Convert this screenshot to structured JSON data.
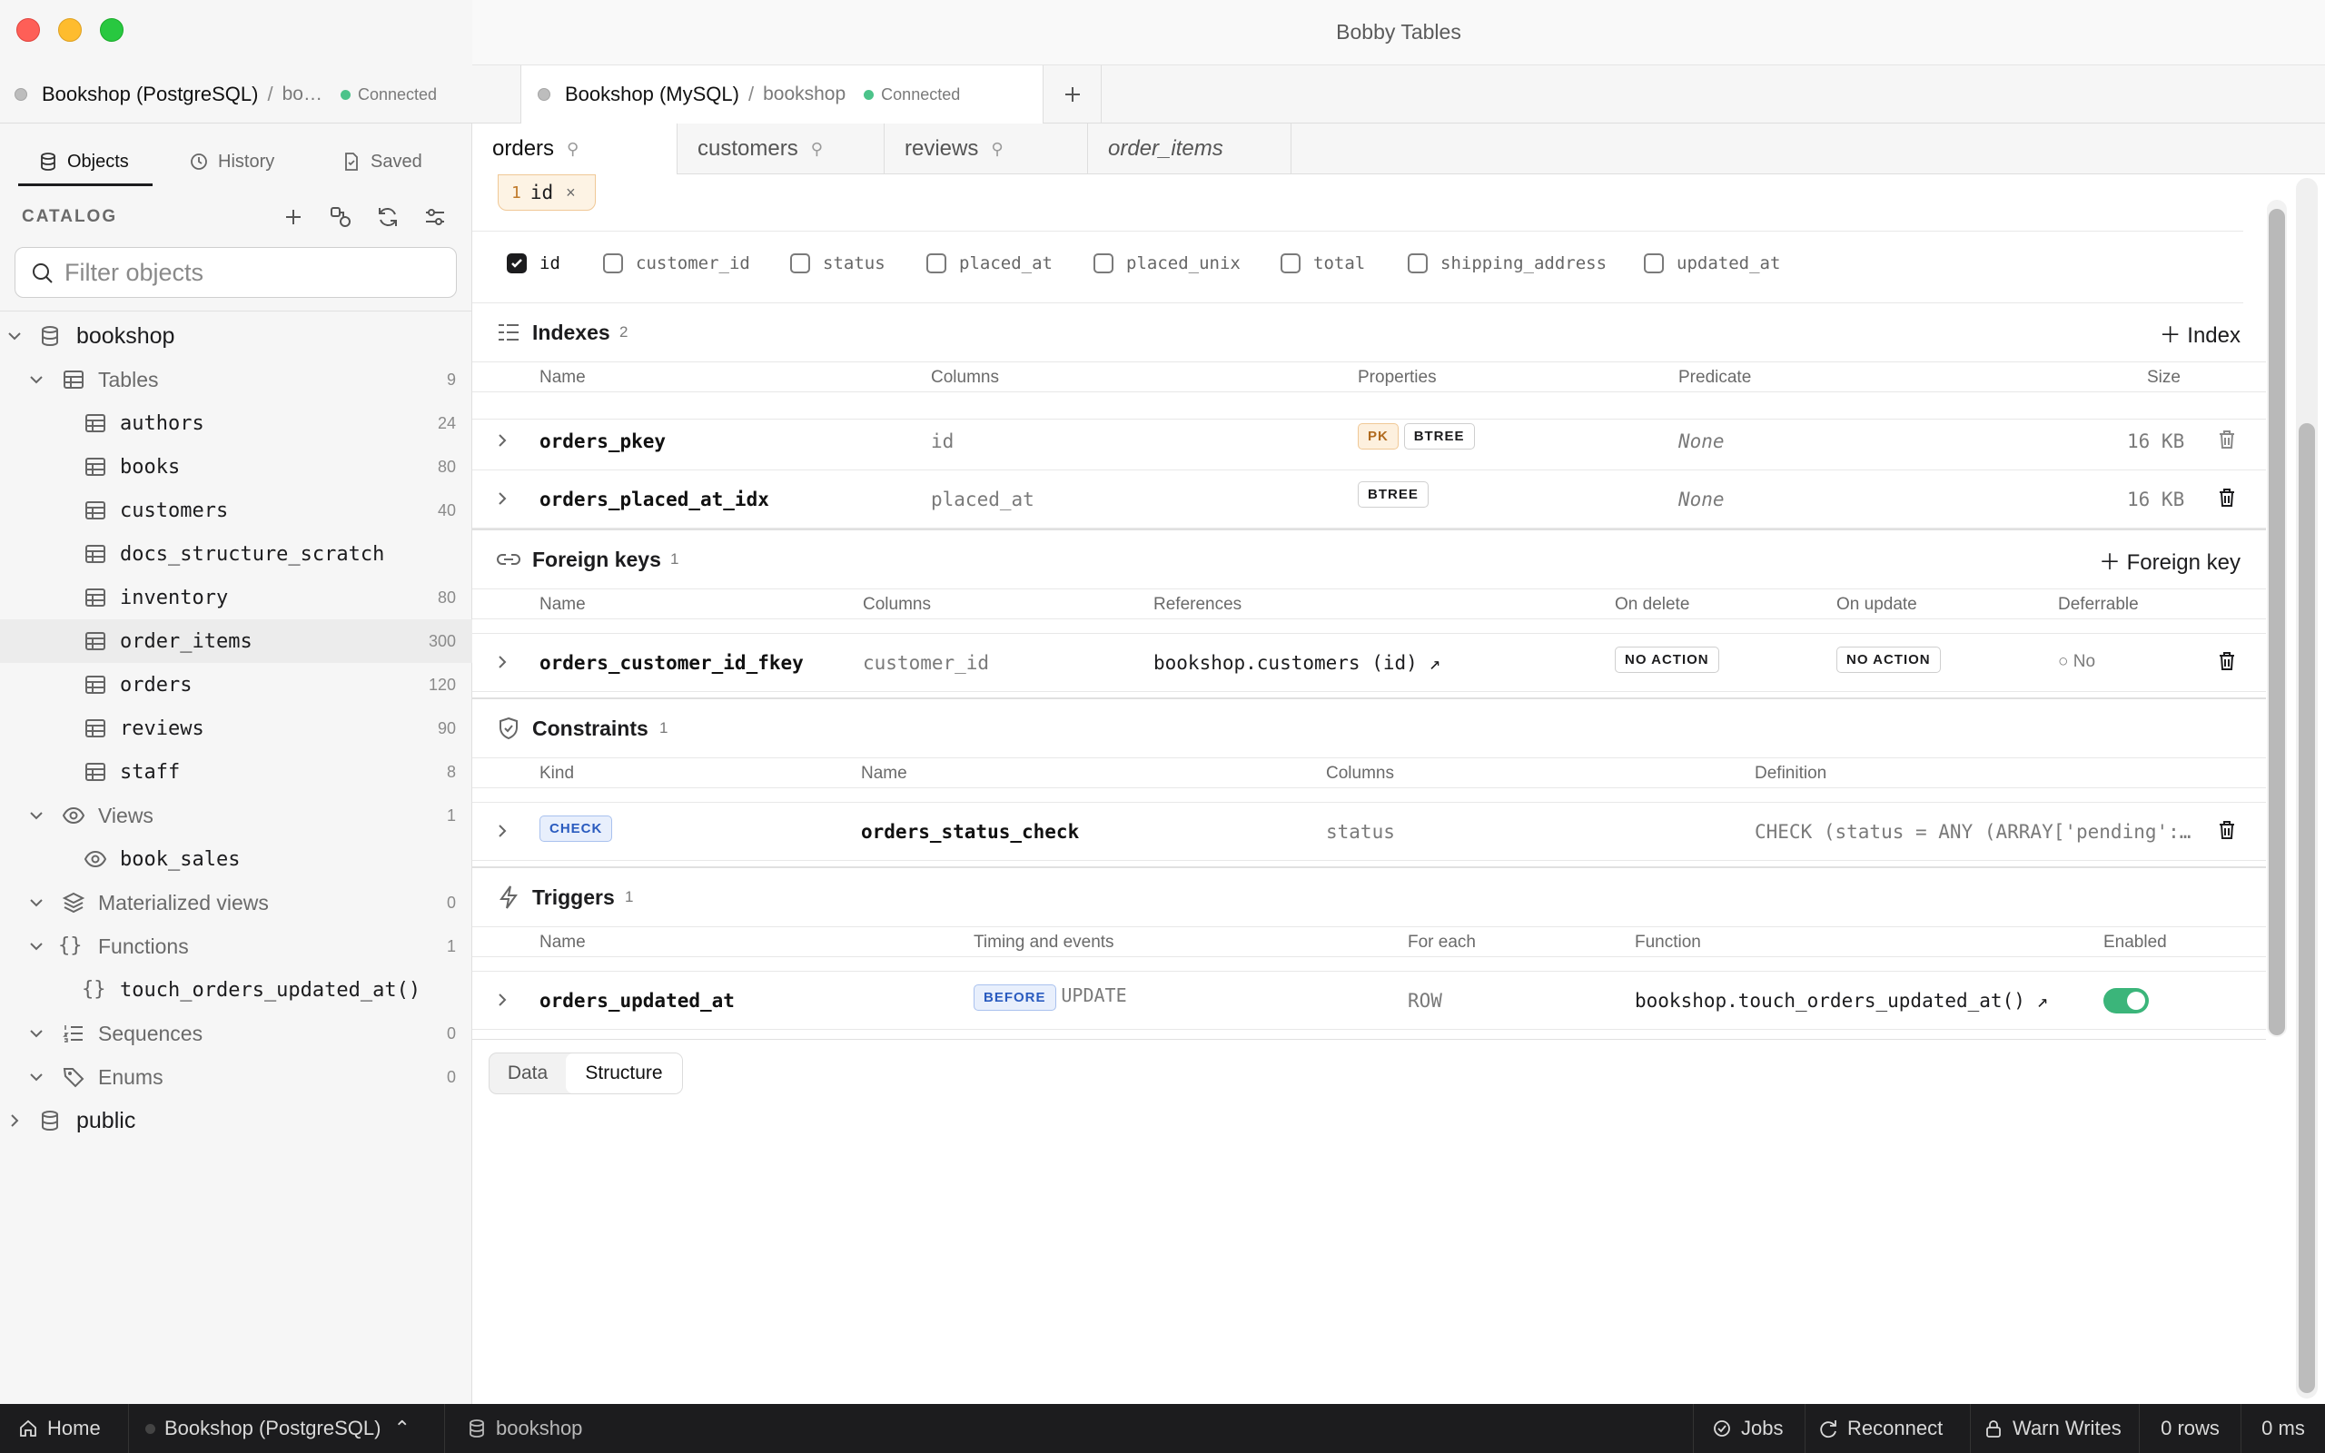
{
  "window": {
    "title": "Bobby Tables"
  },
  "conn_tabs": [
    {
      "name": "Bookshop (PostgreSQL)",
      "sep": "/",
      "db": "bo…",
      "status": "Connected"
    },
    {
      "name": "Bookshop (MySQL)",
      "sep": "/",
      "db": "bookshop",
      "status": "Connected"
    }
  ],
  "sidebar": {
    "tabs": [
      "Objects",
      "History",
      "Saved"
    ],
    "catalog_label": "CATALOG",
    "filter_placeholder": "Filter objects",
    "tree": {
      "db1": "bookshop",
      "tables_label": "Tables",
      "tables_count": "9",
      "tables": [
        {
          "name": "authors",
          "count": "24"
        },
        {
          "name": "books",
          "count": "80"
        },
        {
          "name": "customers",
          "count": "40"
        },
        {
          "name": "docs_structure_scratch",
          "count": ""
        },
        {
          "name": "inventory",
          "count": "80"
        },
        {
          "name": "order_items",
          "count": "300"
        },
        {
          "name": "orders",
          "count": "120"
        },
        {
          "name": "reviews",
          "count": "90"
        },
        {
          "name": "staff",
          "count": "8"
        }
      ],
      "views_label": "Views",
      "views_count": "1",
      "view1": "book_sales",
      "matviews_label": "Materialized views",
      "matviews_count": "0",
      "functions_label": "Functions",
      "functions_count": "1",
      "function1": "touch_orders_updated_at()",
      "sequences_label": "Sequences",
      "sequences_count": "0",
      "enums_label": "Enums",
      "enums_count": "0",
      "db2": "public"
    }
  },
  "obj_tabs": [
    "orders",
    "customers",
    "reviews",
    "order_items"
  ],
  "filter_chip": {
    "num": "1",
    "label": "id",
    "close": "×"
  },
  "columns": [
    "id",
    "customer_id",
    "status",
    "placed_at",
    "placed_unix",
    "total",
    "shipping_address",
    "updated_at"
  ],
  "indexes": {
    "title": "Indexes",
    "count": "2",
    "add": "Index",
    "headers": [
      "Name",
      "Columns",
      "Properties",
      "Predicate",
      "Size"
    ],
    "rows": [
      {
        "name": "orders_pkey",
        "columns": "id",
        "pk": "PK",
        "type": "BTREE",
        "predicate": "None",
        "size": "16 KB"
      },
      {
        "name": "orders_placed_at_idx",
        "columns": "placed_at",
        "type": "BTREE",
        "predicate": "None",
        "size": "16 KB"
      }
    ]
  },
  "fks": {
    "title": "Foreign keys",
    "count": "1",
    "add": "Foreign key",
    "headers": [
      "Name",
      "Columns",
      "References",
      "On delete",
      "On update",
      "Deferrable"
    ],
    "row": {
      "name": "orders_customer_id_fkey",
      "columns": "customer_id",
      "ref": "bookshop.customers (id)",
      "on_delete": "NO ACTION",
      "on_update": "NO ACTION",
      "deferrable": "No"
    }
  },
  "constraints": {
    "title": "Constraints",
    "count": "1",
    "headers": [
      "Kind",
      "Name",
      "Columns",
      "Definition"
    ],
    "row": {
      "kind": "CHECK",
      "name": "orders_status_check",
      "columns": "status",
      "definition": "CHECK (status = ANY (ARRAY['pending':…"
    }
  },
  "triggers": {
    "title": "Triggers",
    "count": "1",
    "headers": [
      "Name",
      "Timing and events",
      "For each",
      "Function",
      "Enabled"
    ],
    "row": {
      "name": "orders_updated_at",
      "timing": "BEFORE",
      "event": "UPDATE",
      "for_each": "ROW",
      "function": "bookshop.touch_orders_updated_at()",
      "enabled": true
    }
  },
  "view_toggle": [
    "Data",
    "Structure"
  ],
  "status_bar": {
    "home": "Home",
    "conn": "Bookshop (PostgreSQL)",
    "db": "bookshop",
    "jobs": "Jobs",
    "reconnect": "Reconnect",
    "warn": "Warn Writes",
    "rows": "0 rows",
    "ms": "0 ms"
  },
  "colors": {
    "accent_green": "#4cc38a",
    "toggle_green": "#3bb57a",
    "pk_orange": "#b06a1e",
    "check_blue": "#2a5bbf"
  }
}
